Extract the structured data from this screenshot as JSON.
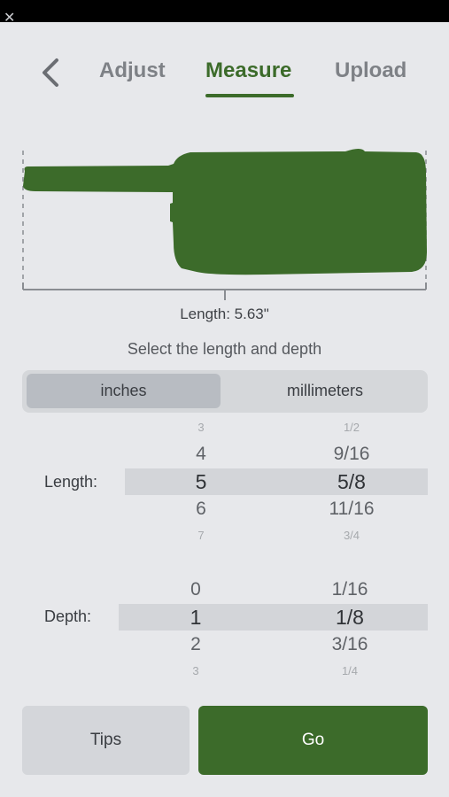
{
  "header": {
    "tabs": [
      {
        "label": "Adjust"
      },
      {
        "label": "Measure"
      },
      {
        "label": "Upload"
      }
    ],
    "active_tab": "Measure"
  },
  "measurement": {
    "length_readout": "Length: 5.63\"",
    "instruction": "Select the length and depth"
  },
  "units": {
    "options": [
      "inches",
      "millimeters"
    ],
    "selected": "inches"
  },
  "length_picker": {
    "label": "Length:",
    "whole": [
      "3",
      "4",
      "5",
      "6",
      "7"
    ],
    "fraction": [
      "1/2",
      "9/16",
      "5/8",
      "11/16",
      "3/4"
    ],
    "selected_whole": "5",
    "selected_fraction": "5/8"
  },
  "depth_picker": {
    "label": "Depth:",
    "whole": [
      "0",
      "1",
      "2",
      "3"
    ],
    "fraction": [
      "1/16",
      "1/8",
      "3/16",
      "1/4"
    ],
    "selected_whole": "1",
    "selected_fraction": "1/8"
  },
  "buttons": {
    "tips": "Tips",
    "go": "Go"
  },
  "colors": {
    "accent": "#3c6b2a",
    "background": "#e7e8eb"
  }
}
